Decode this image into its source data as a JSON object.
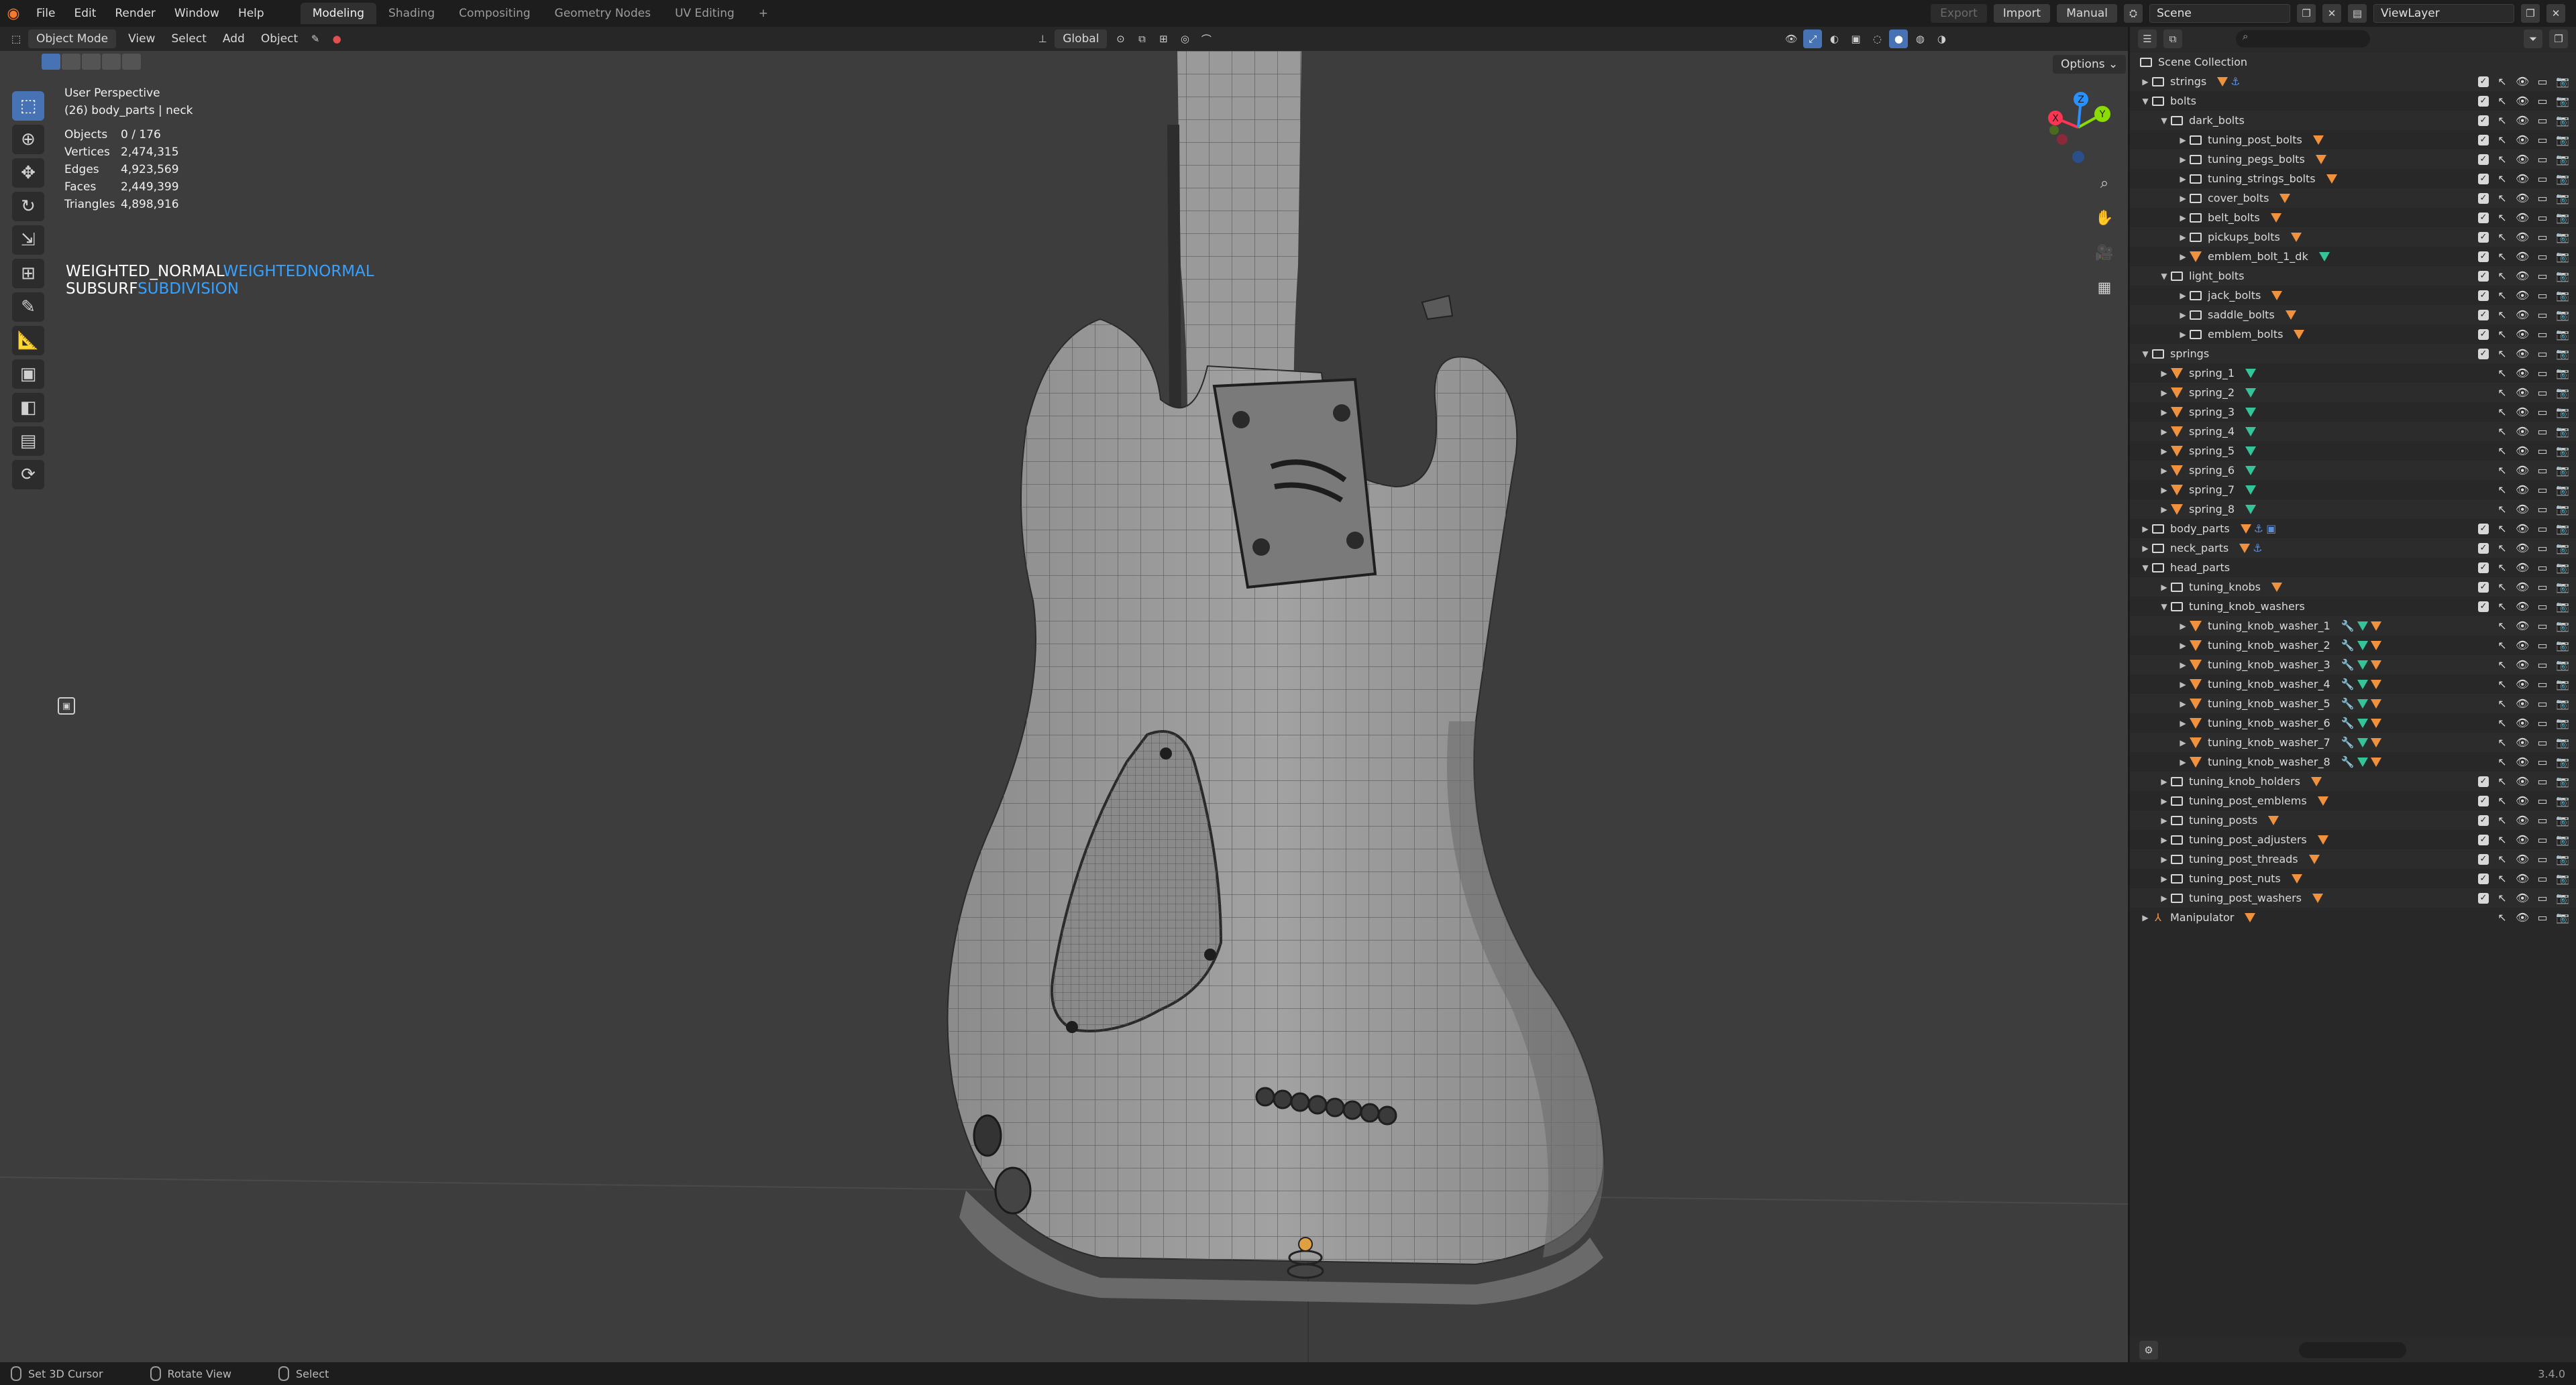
{
  "menus": [
    "File",
    "Edit",
    "Render",
    "Window",
    "Help"
  ],
  "workspaces": [
    "Modeling",
    "Shading",
    "Compositing",
    "Geometry Nodes",
    "UV Editing",
    "+"
  ],
  "topright": {
    "export": "Export",
    "import": "Import",
    "manual": "Manual",
    "scene": "Scene",
    "viewlayer": "ViewLayer"
  },
  "viewport_header": {
    "mode": "Object Mode",
    "menus": [
      "View",
      "Select",
      "Add",
      "Object"
    ],
    "orientation": "Global",
    "options": "Options"
  },
  "stats": {
    "perspective": "User Perspective",
    "object": "(26) body_parts | neck",
    "rows": [
      {
        "k": "Objects",
        "v": "0 / 176"
      },
      {
        "k": "Vertices",
        "v": "2,474,315"
      },
      {
        "k": "Edges",
        "v": "4,923,569"
      },
      {
        "k": "Faces",
        "v": "2,449,399"
      },
      {
        "k": "Triangles",
        "v": "4,898,916"
      }
    ]
  },
  "modifiers": [
    {
      "white": "WEIGHTED_NORMAL",
      "blue": "WEIGHTEDNORMAL"
    },
    {
      "white": "SUBSURF",
      "blue": "SUBDIVISION"
    }
  ],
  "gizmo": {
    "x": "X",
    "y": "Y",
    "z": "Z"
  },
  "outliner": {
    "root": "Scene Collection",
    "rows": [
      {
        "d": 0,
        "t": "col",
        "n": "strings",
        "o": "c",
        "x": "m2",
        "r": "c"
      },
      {
        "d": 0,
        "t": "col",
        "n": "bolts",
        "o": "o",
        "r": "c"
      },
      {
        "d": 1,
        "t": "col",
        "n": "dark_bolts",
        "o": "o",
        "r": "c"
      },
      {
        "d": 2,
        "t": "col",
        "n": "tuning_post_bolts",
        "o": "c",
        "x": "m",
        "r": "c"
      },
      {
        "d": 2,
        "t": "col",
        "n": "tuning_pegs_bolts",
        "o": "c",
        "x": "m",
        "r": "c"
      },
      {
        "d": 2,
        "t": "col",
        "n": "tuning_strings_bolts",
        "o": "c",
        "x": "m",
        "r": "c"
      },
      {
        "d": 2,
        "t": "col",
        "n": "cover_bolts",
        "o": "c",
        "x": "m",
        "r": "c"
      },
      {
        "d": 2,
        "t": "col",
        "n": "belt_bolts",
        "o": "c",
        "x": "m",
        "r": "c"
      },
      {
        "d": 2,
        "t": "col",
        "n": "pickups_bolts",
        "o": "c",
        "x": "m",
        "r": "c"
      },
      {
        "d": 2,
        "t": "mesh",
        "n": "emblem_bolt_1_dk",
        "o": "c",
        "x": "g",
        "r": "c"
      },
      {
        "d": 1,
        "t": "col",
        "n": "light_bolts",
        "o": "o",
        "r": "c"
      },
      {
        "d": 2,
        "t": "col",
        "n": "jack_bolts",
        "o": "c",
        "x": "m",
        "r": "c"
      },
      {
        "d": 2,
        "t": "col",
        "n": "saddle_bolts",
        "o": "c",
        "x": "m",
        "r": "c"
      },
      {
        "d": 2,
        "t": "col",
        "n": "emblem_bolts",
        "o": "c",
        "x": "m",
        "r": "c"
      },
      {
        "d": 0,
        "t": "col",
        "n": "springs",
        "o": "o",
        "r": "c"
      },
      {
        "d": 1,
        "t": "mesh",
        "n": "spring_1",
        "o": "c",
        "x": "g",
        "r": "o"
      },
      {
        "d": 1,
        "t": "mesh",
        "n": "spring_2",
        "o": "c",
        "x": "g",
        "r": "o"
      },
      {
        "d": 1,
        "t": "mesh",
        "n": "spring_3",
        "o": "c",
        "x": "g",
        "r": "o"
      },
      {
        "d": 1,
        "t": "mesh",
        "n": "spring_4",
        "o": "c",
        "x": "g",
        "r": "o"
      },
      {
        "d": 1,
        "t": "mesh",
        "n": "spring_5",
        "o": "c",
        "x": "g",
        "r": "o"
      },
      {
        "d": 1,
        "t": "mesh",
        "n": "spring_6",
        "o": "c",
        "x": "g",
        "r": "o"
      },
      {
        "d": 1,
        "t": "mesh",
        "n": "spring_7",
        "o": "c",
        "x": "g",
        "r": "o"
      },
      {
        "d": 1,
        "t": "mesh",
        "n": "spring_8",
        "o": "c",
        "x": "g",
        "r": "o"
      },
      {
        "d": 0,
        "t": "col",
        "n": "body_parts",
        "o": "c",
        "x": "m3",
        "r": "c"
      },
      {
        "d": 0,
        "t": "col",
        "n": "neck_parts",
        "o": "c",
        "x": "m2",
        "r": "c"
      },
      {
        "d": 0,
        "t": "col",
        "n": "head_parts",
        "o": "o",
        "r": "c"
      },
      {
        "d": 1,
        "t": "col",
        "n": "tuning_knobs",
        "o": "c",
        "x": "m",
        "r": "c"
      },
      {
        "d": 1,
        "t": "col",
        "n": "tuning_knob_washers",
        "o": "o",
        "r": "c"
      },
      {
        "d": 2,
        "t": "mesh",
        "n": "tuning_knob_washer_1",
        "o": "c",
        "x": "w",
        "r": "o"
      },
      {
        "d": 2,
        "t": "mesh",
        "n": "tuning_knob_washer_2",
        "o": "c",
        "x": "w",
        "r": "o"
      },
      {
        "d": 2,
        "t": "mesh",
        "n": "tuning_knob_washer_3",
        "o": "c",
        "x": "w",
        "r": "o"
      },
      {
        "d": 2,
        "t": "mesh",
        "n": "tuning_knob_washer_4",
        "o": "c",
        "x": "w",
        "r": "o"
      },
      {
        "d": 2,
        "t": "mesh",
        "n": "tuning_knob_washer_5",
        "o": "c",
        "x": "w",
        "r": "o"
      },
      {
        "d": 2,
        "t": "mesh",
        "n": "tuning_knob_washer_6",
        "o": "c",
        "x": "w",
        "r": "o"
      },
      {
        "d": 2,
        "t": "mesh",
        "n": "tuning_knob_washer_7",
        "o": "c",
        "x": "w",
        "r": "o"
      },
      {
        "d": 2,
        "t": "mesh",
        "n": "tuning_knob_washer_8",
        "o": "c",
        "x": "w",
        "r": "o"
      },
      {
        "d": 1,
        "t": "col",
        "n": "tuning_knob_holders",
        "o": "c",
        "x": "m",
        "r": "c"
      },
      {
        "d": 1,
        "t": "col",
        "n": "tuning_post_emblems",
        "o": "c",
        "x": "m",
        "r": "c"
      },
      {
        "d": 1,
        "t": "col",
        "n": "tuning_posts",
        "o": "c",
        "x": "m",
        "r": "c"
      },
      {
        "d": 1,
        "t": "col",
        "n": "tuning_post_adjusters",
        "o": "c",
        "x": "m",
        "r": "c"
      },
      {
        "d": 1,
        "t": "col",
        "n": "tuning_post_threads",
        "o": "c",
        "x": "m",
        "r": "c"
      },
      {
        "d": 1,
        "t": "col",
        "n": "tuning_post_nuts",
        "o": "c",
        "x": "m",
        "r": "c"
      },
      {
        "d": 1,
        "t": "col",
        "n": "tuning_post_washers",
        "o": "c",
        "x": "m",
        "r": "c"
      },
      {
        "d": 0,
        "t": "arm",
        "n": "Manipulator",
        "o": "c",
        "x": "m",
        "r": "o"
      }
    ]
  },
  "statusbar": {
    "items": [
      "Set 3D Cursor",
      "Rotate View",
      "Select"
    ],
    "version": "3.4.0"
  },
  "colors": {
    "accent": "#4772b3",
    "modifier_blue": "#37a1ff",
    "mesh_orange": "#f0913d",
    "mesh_green": "#35c49a"
  }
}
